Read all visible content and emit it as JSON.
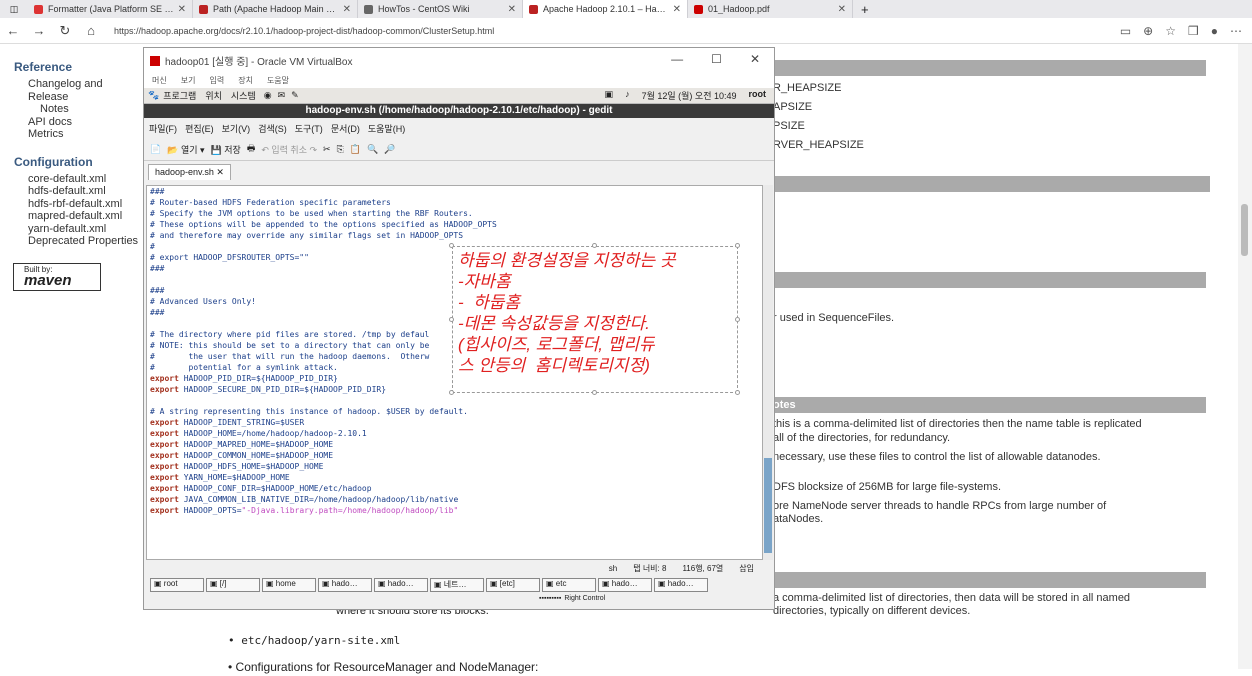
{
  "browser": {
    "tabs": [
      {
        "label": "Formatter (Java Platform SE 8 )",
        "color": "#d33"
      },
      {
        "label": "Path (Apache Hadoop Main 2.10...",
        "color": "#b22"
      },
      {
        "label": "HowTos - CentOS Wiki",
        "color": "#666"
      },
      {
        "label": "Apache Hadoop 2.10.1 – Hadoop...",
        "color": "#b22"
      },
      {
        "label": "01_Hadoop.pdf",
        "color": "#c00"
      }
    ],
    "url": "https://hadoop.apache.org/docs/r2.10.1/hadoop-project-dist/hadoop-common/ClusterSetup.html"
  },
  "doc": {
    "reference_title": "Reference",
    "reference_links": [
      "Changelog and Release",
      "Notes",
      "API docs",
      "Metrics"
    ],
    "config_title": "Configuration",
    "config_links": [
      "core-default.xml",
      "hdfs-default.xml",
      "hdfs-rbf-default.xml",
      "mapred-default.xml",
      "yarn-default.xml",
      "Deprecated Properties"
    ],
    "maven_label": "maven",
    "maven_built": "Built by:",
    "right_rows": [
      "R_HEAPSIZE",
      "APSIZE",
      "PSIZE",
      "RVER_HEAPSIZE",
      "r used in SequenceFiles.",
      "otes",
      "this is a comma-delimited list of directories then the name table is replicated",
      "all of the directories, for redundancy.",
      "necessary, use these files to control the list of allowable datanodes.",
      "DFS blocksize of 256MB for large file-systems.",
      "ore NameNode server threads to handle RPCs from large number of",
      "ataNodes.",
      "a comma-delimited list of directories, then data will be stored in all named",
      "directories, typically on different devices."
    ],
    "bottom_text_1": "where it should store its blocks.",
    "bullet_1": "etc/hadoop/yarn-site.xml",
    "bullet_2": "Configurations for ResourceManager and NodeManager:"
  },
  "vm": {
    "title": "hadoop01 [실행 중] - Oracle VM VirtualBox",
    "menu": [
      "머신",
      "보기",
      "입력",
      "장치",
      "도움말"
    ],
    "gnome_menu": [
      "프로그램",
      "위치",
      "시스템"
    ],
    "clock": "7월 12일 (월) 오전 10:49",
    "user": "root",
    "gedit_title": "hadoop-env.sh (/home/hadoop/hadoop-2.10.1/etc/hadoop) - gedit",
    "gedit_menu": [
      "파일(F)",
      "편집(E)",
      "보기(V)",
      "검색(S)",
      "도구(T)",
      "문서(D)",
      "도움말(H)"
    ],
    "toolbar": {
      "open": "열기",
      "save": "저장",
      "undo": "입력 취소"
    },
    "file_tab": "hadoop-env.sh",
    "status_lang": "sh",
    "status_tab": "탭 너비: 8",
    "status_pos": "116행, 67열",
    "status_mode": "삽입",
    "taskbar": [
      "root",
      "[/]",
      "home",
      "hado…",
      "hado…",
      "네트…",
      "[etc]",
      "etc",
      "hado…",
      "hado…"
    ],
    "right_control": "Right Control"
  },
  "editor_lines": [
    [
      "cm",
      "###"
    ],
    [
      "cm",
      "# Router-based HDFS Federation specific parameters"
    ],
    [
      "cm",
      "# Specify the JVM options to be used when starting the RBF Routers."
    ],
    [
      "cm",
      "# These options will be appended to the options specified as HADOOP_OPTS"
    ],
    [
      "cm",
      "# and therefore may override any similar flags set in HADOOP_OPTS"
    ],
    [
      "cm",
      "#"
    ],
    [
      "cm",
      "# export HADOOP_DFSROUTER_OPTS=\"\""
    ],
    [
      "cm",
      "###"
    ],
    [
      "cm",
      ""
    ],
    [
      "cm",
      "###"
    ],
    [
      "cm",
      "# Advanced Users Only!"
    ],
    [
      "cm",
      "###"
    ],
    [
      "cm",
      ""
    ],
    [
      "cm",
      "# The directory where pid files are stored. /tmp by defaul"
    ],
    [
      "cm",
      "# NOTE: this should be set to a directory that can only be"
    ],
    [
      "cm",
      "#       the user that will run the hadoop daemons.  Otherw"
    ],
    [
      "cm",
      "#       potential for a symlink attack."
    ],
    [
      "kw",
      "export",
      "cm",
      " HADOOP_PID_DIR=${HADOOP_PID_DIR}"
    ],
    [
      "kw",
      "export",
      "cm",
      " HADOOP_SECURE_DN_PID_DIR=${HADOOP_PID_DIR}"
    ],
    [
      "cm",
      ""
    ],
    [
      "cm",
      "# A string representing this instance of hadoop. $USER by default."
    ],
    [
      "kw",
      "export",
      "cm",
      " HADOOP_IDENT_STRING=$USER"
    ],
    [
      "kw",
      "export",
      "cm",
      " HADOOP_HOME=/home/hadoop/hadoop-2.10.1"
    ],
    [
      "kw",
      "export",
      "cm",
      " HADOOP_MAPRED_HOME=$HADOOP_HOME"
    ],
    [
      "kw",
      "export",
      "cm",
      " HADOOP_COMMON_HOME=$HADOOP_HOME"
    ],
    [
      "kw",
      "export",
      "cm",
      " HADOOP_HDFS_HOME=$HADOOP_HOME"
    ],
    [
      "kw",
      "export",
      "cm",
      " YARN_HOME=$HADOOP_HOME"
    ],
    [
      "kw",
      "export",
      "cm",
      " HADOOP_CONF_DIR=$HADOOP_HOME/etc/hadoop"
    ],
    [
      "kw",
      "export",
      "cm",
      " JAVA_COMMON_LIB_NATIVE_DIR=/home/hadoop/hadoop/lib/native"
    ],
    [
      "kw",
      "export",
      "cm",
      " HADOOP_OPTS=",
      "st",
      "\"-Djava.library.path=/home/hadoop/hadoop/lib\""
    ]
  ],
  "annotation": "하둡의 환경설정을 지정하는 곳\n-자바홈\n-  하둡홈\n-데몬 속성값등을 지정한다.\n(힙사이즈, 로그폴더, 맵리듀\n스 안등의  홈디렉토리지정)"
}
